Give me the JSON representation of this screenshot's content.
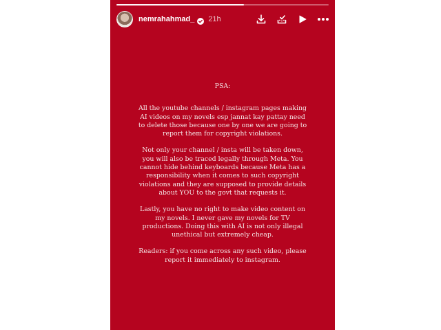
{
  "story": {
    "progress": 0.6,
    "username": "nemrahahmad_",
    "time": "21h",
    "icons": {
      "verified": "verified-badge-icon",
      "download": "download-icon",
      "share_update": "share-update-icon",
      "play": "play-icon",
      "more": "more-icon"
    }
  },
  "post": {
    "heading": "PSA:",
    "paragraphs": [
      "All the youtube channels / instagram pages making AI videos on my novels esp jannat kay pattay need to delete those because one by one we are going to report them for copyright violations.",
      "Not only your channel / insta will be taken down, you will also be traced legally through Meta. You cannot hide behind keyboards because Meta has a responsibility when it comes to such copyright violations and they are supposed to provide details about YOU to the govt that requests it.",
      "Lastly, you have no right to make video content on my novels. I never gave my novels for TV productions. Doing this with AI is not only illegal unethical but extremely cheap.",
      "Readers: if you come across any such video, please report it immediately to instagram."
    ]
  },
  "colors": {
    "background": "#b5041f",
    "text": "#f4e6e6"
  }
}
